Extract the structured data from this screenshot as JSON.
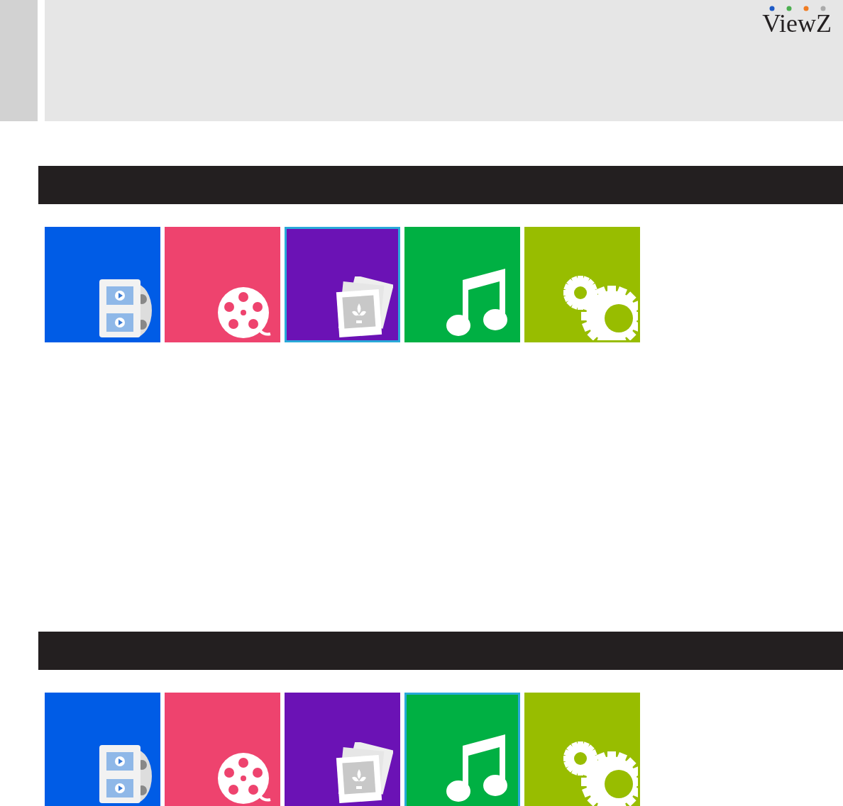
{
  "logo": {
    "text": "ViewZ"
  },
  "menus": [
    {
      "tiles": [
        {
          "kind": "video",
          "color": "#005ce6",
          "selected": false
        },
        {
          "kind": "movie",
          "color": "#ee436e",
          "selected": false
        },
        {
          "kind": "photo",
          "color": "#6b12b5",
          "selected": true
        },
        {
          "kind": "music",
          "color": "#00b043",
          "selected": false
        },
        {
          "kind": "settings",
          "color": "#98bd00",
          "selected": false
        }
      ]
    },
    {
      "tiles": [
        {
          "kind": "video",
          "color": "#005ce6",
          "selected": false
        },
        {
          "kind": "movie",
          "color": "#ee436e",
          "selected": false
        },
        {
          "kind": "photo",
          "color": "#6b12b5",
          "selected": false
        },
        {
          "kind": "music",
          "color": "#00b043",
          "selected": true
        },
        {
          "kind": "settings",
          "color": "#98bd00",
          "selected": false
        }
      ]
    }
  ]
}
